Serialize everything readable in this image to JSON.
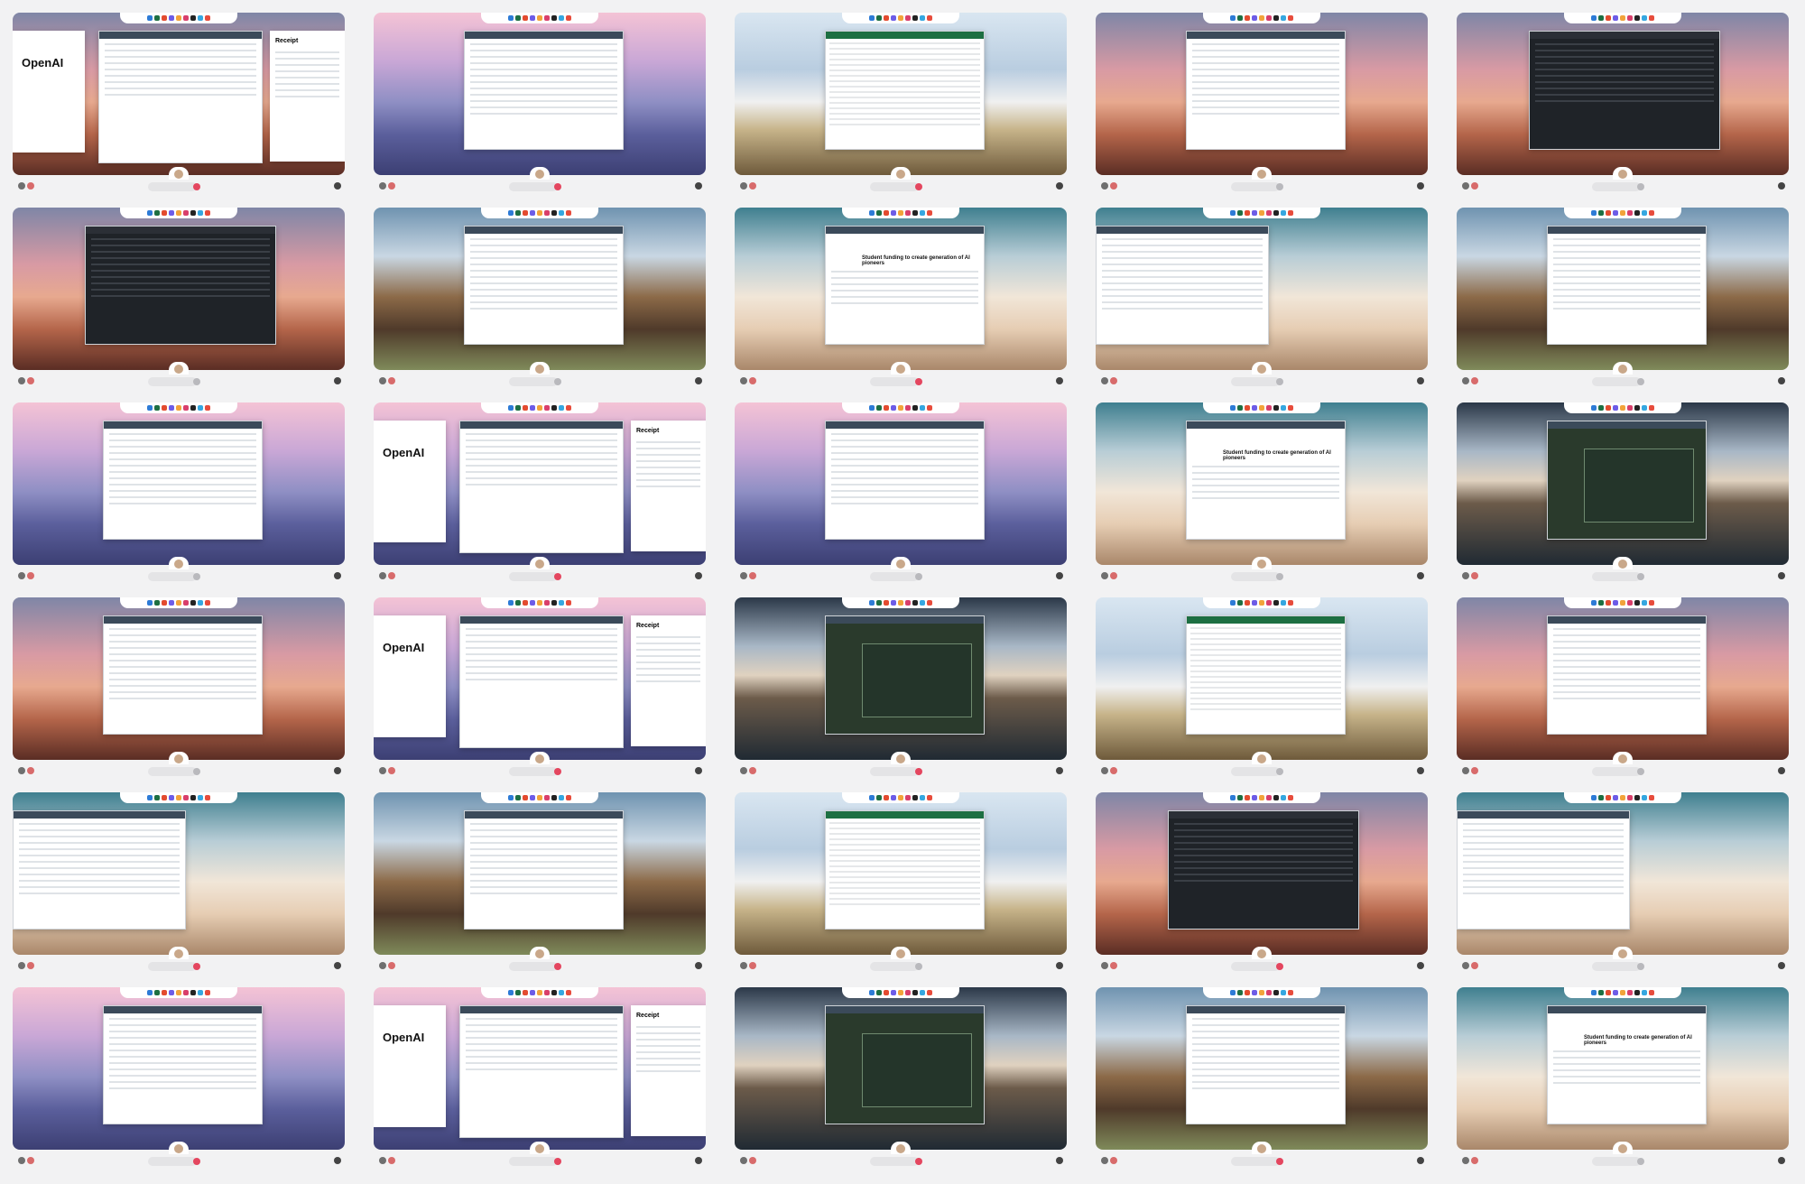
{
  "cards": [
    {
      "bg": "pink",
      "content": "openai",
      "header_text": "OpenAI",
      "receipt_label": "Receipt",
      "footer_pill": "#e4465f"
    },
    {
      "bg": "purple",
      "content": "sap",
      "footer_pill": "#e4465f"
    },
    {
      "bg": "snow",
      "content": "excel",
      "footer_pill": "#e4465f"
    },
    {
      "bg": "pink",
      "content": "calendar",
      "footer_pill": "#b9b9bd"
    },
    {
      "bg": "pink",
      "content": "dark",
      "footer_pill": "#b9b9bd"
    },
    {
      "bg": "pink",
      "content": "dark",
      "footer_pill": "#b9b9bd"
    },
    {
      "bg": "canyon",
      "content": "doc",
      "footer_pill": "#b9b9bd"
    },
    {
      "bg": "desert",
      "content": "news",
      "headline": "Student funding to create generation of AI pioneers",
      "footer_pill": "#e4465f"
    },
    {
      "bg": "desert",
      "content": "article",
      "footer_pill": "#b9b9bd"
    },
    {
      "bg": "canyon",
      "content": "doc",
      "footer_pill": "#b9b9bd"
    },
    {
      "bg": "purple",
      "content": "sap",
      "footer_pill": "#b9b9bd"
    },
    {
      "bg": "purple",
      "content": "openai",
      "header_text": "OpenAI",
      "receipt_label": "Receipt",
      "footer_pill": "#e4465f"
    },
    {
      "bg": "purple",
      "content": "sap",
      "footer_pill": "#b9b9bd"
    },
    {
      "bg": "desert",
      "content": "news",
      "headline": "Student funding to create generation of AI pioneers",
      "footer_pill": "#b9b9bd"
    },
    {
      "bg": "lake",
      "content": "slides",
      "footer_pill": "#b9b9bd"
    },
    {
      "bg": "pink",
      "content": "calendar",
      "footer_pill": "#b9b9bd"
    },
    {
      "bg": "purple",
      "content": "openai",
      "header_text": "OpenAI",
      "receipt_label": "Receipt",
      "footer_pill": "#e4465f"
    },
    {
      "bg": "lake",
      "content": "slides",
      "footer_pill": "#e4465f"
    },
    {
      "bg": "snow",
      "content": "excel",
      "footer_pill": "#b9b9bd"
    },
    {
      "bg": "pink",
      "content": "calendar",
      "footer_pill": "#b9b9bd"
    },
    {
      "bg": "desert",
      "content": "article",
      "footer_pill": "#e4465f"
    },
    {
      "bg": "canyon",
      "content": "doc",
      "footer_pill": "#e4465f"
    },
    {
      "bg": "snow",
      "content": "excel",
      "footer_pill": "#b9b9bd"
    },
    {
      "bg": "pink",
      "content": "dark",
      "footer_pill": "#e4465f"
    },
    {
      "bg": "desert",
      "content": "article",
      "footer_pill": "#b9b9bd"
    },
    {
      "bg": "purple",
      "content": "sap",
      "footer_pill": "#e4465f"
    },
    {
      "bg": "purple",
      "content": "openai",
      "header_text": "OpenAI",
      "receipt_label": "Receipt",
      "footer_pill": "#e4465f"
    },
    {
      "bg": "lake",
      "content": "slides",
      "footer_pill": "#e4465f"
    },
    {
      "bg": "canyon",
      "content": "doc",
      "footer_pill": "#e4465f"
    },
    {
      "bg": "desert",
      "content": "news",
      "headline": "Student funding to create generation of AI pioneers",
      "footer_pill": "#b9b9bd"
    }
  ],
  "dock_colors": [
    "#2d7bd6",
    "#1d6f42",
    "#e34b2f",
    "#6d5ce7",
    "#f2a33a",
    "#d93f6b",
    "#222",
    "#35a7e0",
    "#e74c3c"
  ]
}
